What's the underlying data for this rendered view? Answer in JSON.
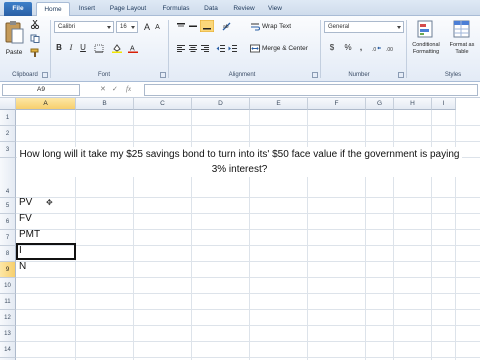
{
  "tabs": [
    "File",
    "Home",
    "Insert",
    "Page Layout",
    "Formulas",
    "Data",
    "Review",
    "View"
  ],
  "active_tab": "Home",
  "ribbon": {
    "clipboard": {
      "paste_label": "Paste",
      "group_label": "Clipboard"
    },
    "font": {
      "font_name": "Calibri",
      "font_size": "16",
      "group_label": "Font",
      "bold": "B",
      "italic": "I",
      "underline": "U",
      "grow": "A",
      "shrink": "A"
    },
    "alignment": {
      "wrap_text": "Wrap Text",
      "merge_center": "Merge & Center",
      "group_label": "Alignment"
    },
    "number": {
      "format": "General",
      "currency": "$",
      "percent": "%",
      "comma": ",",
      "group_label": "Number"
    },
    "styles": {
      "conditional_formatting": "Conditional Formatting",
      "format_as_table": "Format as Table",
      "group_label": "Styles"
    }
  },
  "formula_bar": {
    "name_box": "A9",
    "fx_label": "fx",
    "content": ""
  },
  "columns": [
    "A",
    "B",
    "C",
    "D",
    "E",
    "F",
    "G",
    "H",
    "I"
  ],
  "selected_column": "A",
  "rows": [
    "1",
    "2",
    "3",
    "4",
    "5",
    "6",
    "7",
    "8",
    "9",
    "10",
    "11",
    "12",
    "13",
    "14",
    "15"
  ],
  "selected_row": "9",
  "cells": {
    "question": "How long will it take my $25 savings bond to turn into its' $50 face value if the government is paying 3% interest?",
    "A6": "PV",
    "A7": "FV",
    "A8": "PMT",
    "A9": "I",
    "A10": "N"
  }
}
